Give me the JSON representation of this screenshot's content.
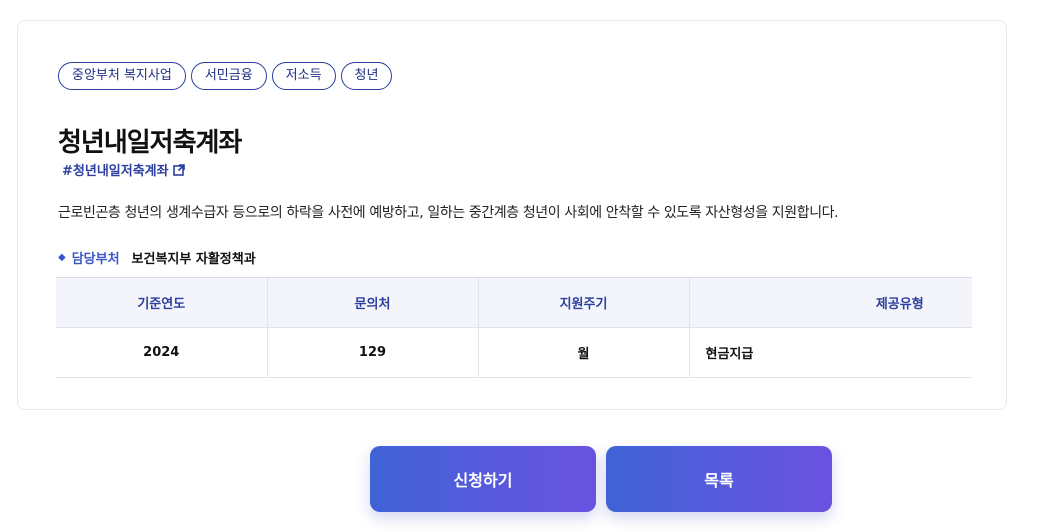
{
  "tags": [
    "중앙부처 복지사업",
    "서민금융",
    "저소득",
    "청년"
  ],
  "title": "청년내일저축계좌",
  "hashtag": "#청년내일저축계좌",
  "description": "근로빈곤층 청년의 생계수급자 등으로의 하락을 사전에 예방하고, 일하는 중간계층 청년이 사회에 안착할 수 있도록 자산형성을 지원합니다.",
  "department": {
    "bullet": "◆",
    "label": "담당부처",
    "value": "보건복지부 자활정책과"
  },
  "table": {
    "headers": [
      "기준연도",
      "문의처",
      "지원주기",
      "제공유형"
    ],
    "row": [
      "2024",
      "129",
      "월",
      "현금지급"
    ]
  },
  "buttons": {
    "apply": "신청하기",
    "list": "목록"
  },
  "colors": {
    "accent": "#2c3fa0",
    "button_gradient_start": "#3f63d6",
    "button_gradient_end": "#6a52e0",
    "header_bg": "#f3f5fa"
  },
  "icons": {
    "hashtag_link": "external-link-icon"
  }
}
